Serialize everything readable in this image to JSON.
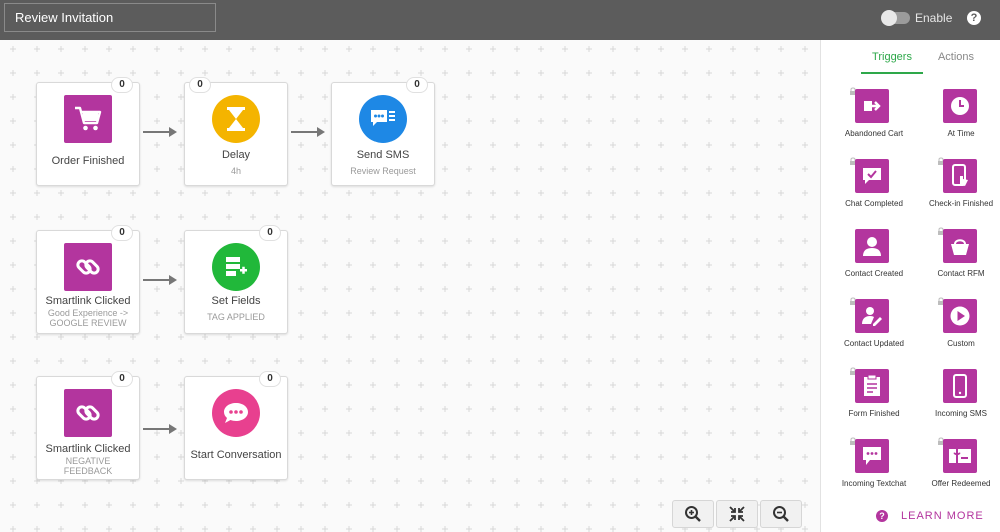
{
  "header": {
    "title_value": "Review Invitation",
    "enable_label": "Enable",
    "help_glyph": "?"
  },
  "flow": {
    "row1": {
      "order_finished": {
        "label": "Order Finished",
        "count": "0"
      },
      "delay": {
        "label": "Delay",
        "sub": "4h",
        "count": "0"
      },
      "send_sms": {
        "label": "Send SMS",
        "sub": "Review Request",
        "count": "0"
      }
    },
    "row2": {
      "smartlink": {
        "label": "Smartlink Clicked",
        "sub": "Good Experience -> GOOGLE REVIEW",
        "count": "0"
      },
      "set_fields": {
        "label": "Set Fields",
        "sub": "TAG APPLIED",
        "count": "0"
      }
    },
    "row3": {
      "smartlink": {
        "label": "Smartlink Clicked",
        "sub": "NEGATIVE FEEDBACK",
        "count": "0"
      },
      "start_conversation": {
        "label": "Start Conversation",
        "count": "0"
      }
    }
  },
  "sidebar": {
    "tabs": {
      "triggers": "Triggers",
      "actions": "Actions"
    },
    "triggers": [
      {
        "label": "Abandoned Cart",
        "icon": "cart-exit-icon",
        "locked": true
      },
      {
        "label": "At Time",
        "icon": "clock-icon",
        "locked": false
      },
      {
        "label": "Chat Completed",
        "icon": "chat-check-icon",
        "locked": true
      },
      {
        "label": "Check-in Finished",
        "icon": "phone-touch-icon",
        "locked": true
      },
      {
        "label": "Contact Created",
        "icon": "person-icon",
        "locked": false
      },
      {
        "label": "Contact RFM",
        "icon": "basket-icon",
        "locked": true
      },
      {
        "label": "Contact Updated",
        "icon": "person-edit-icon",
        "locked": true
      },
      {
        "label": "Custom",
        "icon": "play-icon",
        "locked": true
      },
      {
        "label": "Form Finished",
        "icon": "clipboard-icon",
        "locked": true
      },
      {
        "label": "Incoming SMS",
        "icon": "mobile-icon",
        "locked": false
      },
      {
        "label": "Incoming Textchat",
        "icon": "chat-bubble-icon",
        "locked": true
      },
      {
        "label": "Offer Redeemed",
        "icon": "gift-card-icon",
        "locked": true
      }
    ],
    "learn_more": "LEARN MORE",
    "help_glyph": "?"
  },
  "colors": {
    "header": "#5c5c5c",
    "magenta": "#b3359e",
    "yellow": "#f4b400",
    "blue": "#1e88e5",
    "green": "#21b83a",
    "pink": "#e8408f",
    "tab_active": "#2ea84a"
  }
}
